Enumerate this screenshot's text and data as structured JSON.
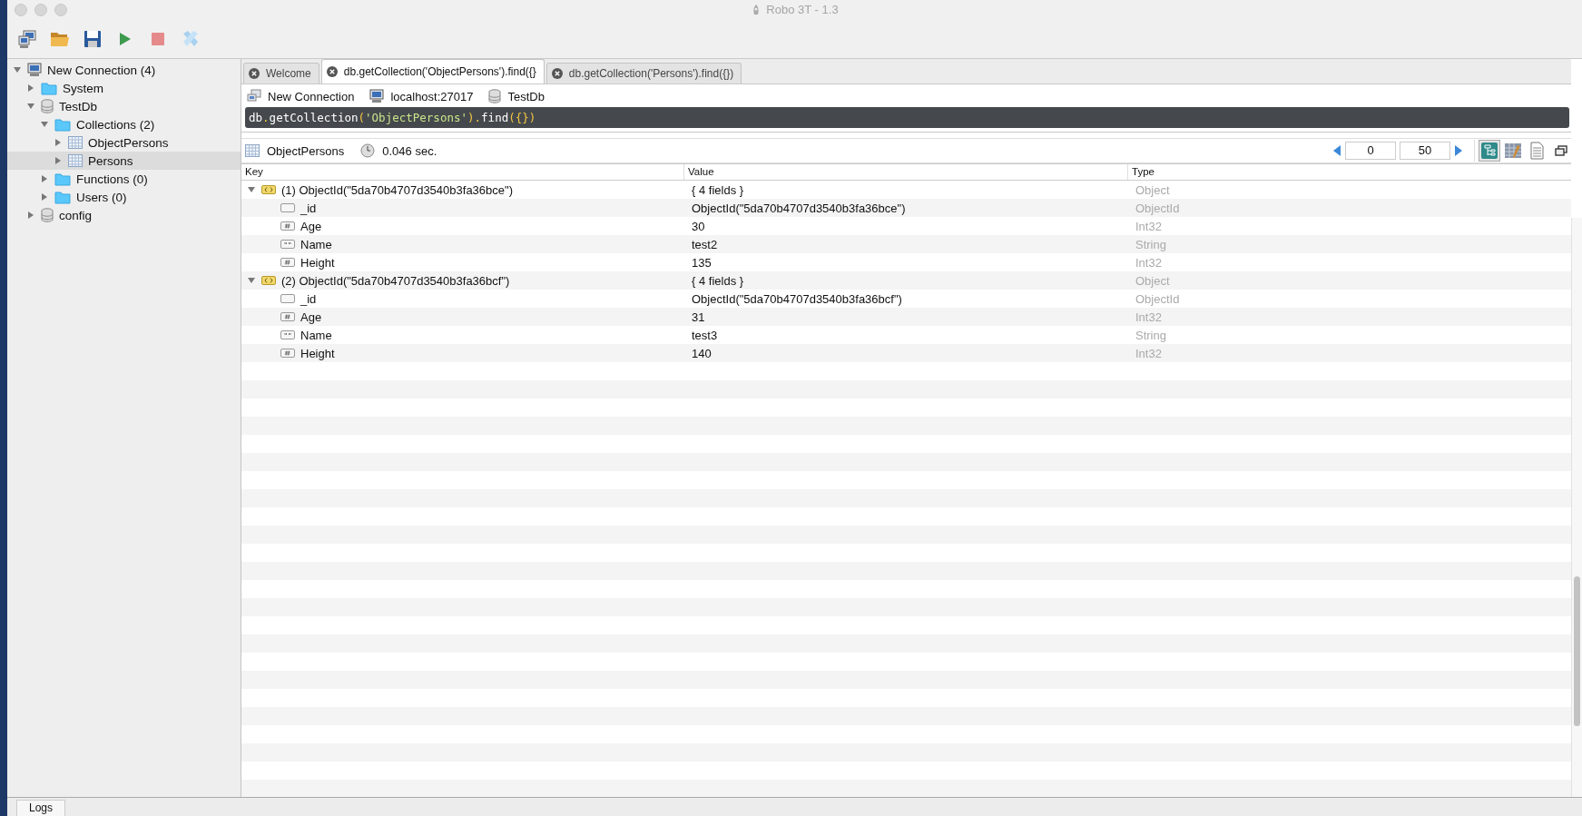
{
  "window": {
    "title": "Robo 3T - 1.3"
  },
  "sidebar": {
    "tree": [
      {
        "label": "New Connection (4)",
        "kind": "server",
        "expanded": true,
        "selected": false,
        "children": [
          {
            "label": "System",
            "kind": "folder",
            "expanded": false,
            "selected": false
          },
          {
            "label": "TestDb",
            "kind": "database",
            "expanded": true,
            "selected": false,
            "children": [
              {
                "label": "Collections (2)",
                "kind": "folder",
                "expanded": true,
                "selected": false,
                "children": [
                  {
                    "label": "ObjectPersons",
                    "kind": "collection",
                    "expanded": false,
                    "selected": false
                  },
                  {
                    "label": "Persons",
                    "kind": "collection",
                    "expanded": false,
                    "selected": true
                  }
                ]
              },
              {
                "label": "Functions (0)",
                "kind": "folder",
                "expanded": false,
                "selected": false
              },
              {
                "label": "Users (0)",
                "kind": "folder",
                "expanded": false,
                "selected": false
              }
            ]
          },
          {
            "label": "config",
            "kind": "database",
            "expanded": false,
            "selected": false
          }
        ]
      }
    ]
  },
  "tabs": [
    {
      "label": "Welcome",
      "selected": false
    },
    {
      "label": "db.getCollection('ObjectPersons').find({}",
      "selected": true
    },
    {
      "label": "db.getCollection('Persons').find({})",
      "selected": false
    }
  ],
  "connection_bar": {
    "connection": "New Connection",
    "server": "localhost:27017",
    "database": "TestDb"
  },
  "query": "db.getCollection('ObjectPersons').find({})",
  "results": {
    "collection": "ObjectPersons",
    "time": "0.046 sec.",
    "skip": "0",
    "limit": "50",
    "view_modes": [
      {
        "kind": "tree",
        "selected": true
      },
      {
        "kind": "table",
        "selected": false
      },
      {
        "kind": "text",
        "selected": false
      }
    ],
    "columns": [
      "Key",
      "Value",
      "Type"
    ],
    "documents": [
      {
        "key": "(1) ObjectId(\"5da70b4707d3540b3fa36bce\")",
        "value": "{ 4 fields }",
        "type": "Object",
        "expanded": true,
        "fields": [
          {
            "kind": "objectid",
            "key": "_id",
            "value": "ObjectId(\"5da70b4707d3540b3fa36bce\")",
            "type": "ObjectId"
          },
          {
            "kind": "number",
            "key": "Age",
            "value": "30",
            "type": "Int32"
          },
          {
            "kind": "string",
            "key": "Name",
            "value": "test2",
            "type": "String"
          },
          {
            "kind": "number",
            "key": "Height",
            "value": "135",
            "type": "Int32"
          }
        ]
      },
      {
        "key": "(2) ObjectId(\"5da70b4707d3540b3fa36bcf\")",
        "value": "{ 4 fields }",
        "type": "Object",
        "expanded": true,
        "fields": [
          {
            "kind": "objectid",
            "key": "_id",
            "value": "ObjectId(\"5da70b4707d3540b3fa36bcf\")",
            "type": "ObjectId"
          },
          {
            "kind": "number",
            "key": "Age",
            "value": "31",
            "type": "Int32"
          },
          {
            "kind": "string",
            "key": "Name",
            "value": "test3",
            "type": "String"
          },
          {
            "kind": "number",
            "key": "Height",
            "value": "140",
            "type": "Int32"
          }
        ]
      }
    ]
  },
  "logs_tab": "Logs"
}
